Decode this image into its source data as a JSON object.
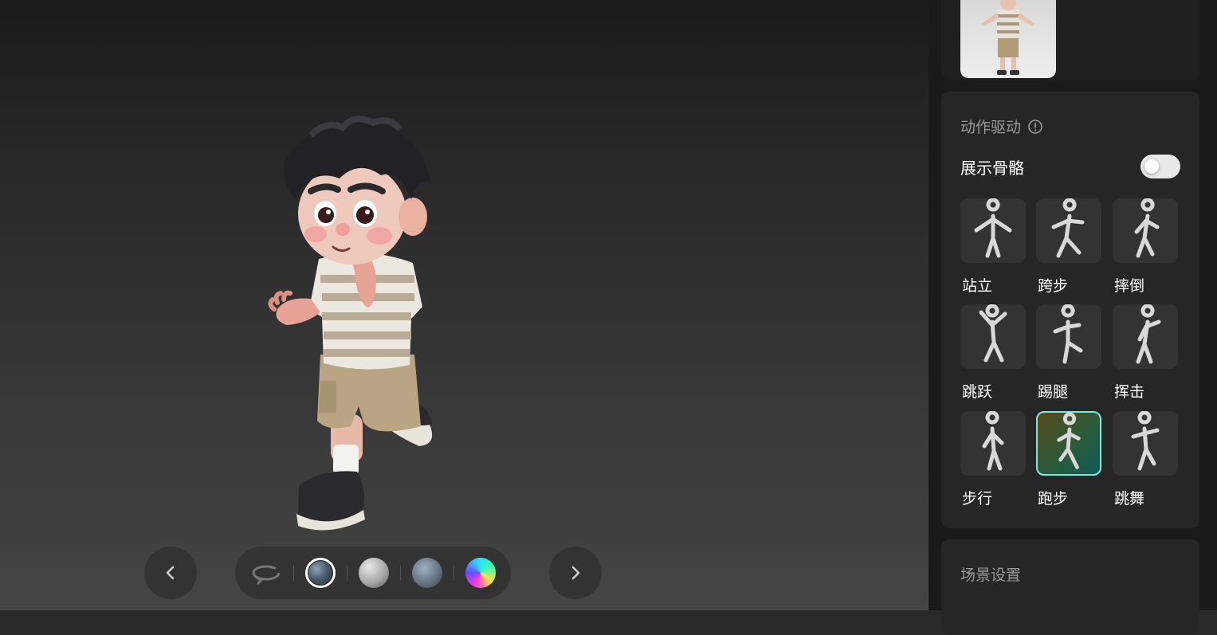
{
  "viewer": {
    "materials": [
      {
        "name": "hdri-sphere-metal",
        "selected": true
      },
      {
        "name": "clay-sphere",
        "selected": false
      },
      {
        "name": "textured-sphere",
        "selected": false
      },
      {
        "name": "rainbow-sphere",
        "selected": false
      }
    ]
  },
  "motion": {
    "title": "动作驱动",
    "show_skeleton_label": "展示骨骼",
    "show_skeleton": true,
    "items": [
      {
        "label": "站立",
        "selected": false
      },
      {
        "label": "跨步",
        "selected": false
      },
      {
        "label": "摔倒",
        "selected": false
      },
      {
        "label": "跳跃",
        "selected": false
      },
      {
        "label": "踢腿",
        "selected": false
      },
      {
        "label": "挥击",
        "selected": false
      },
      {
        "label": "步行",
        "selected": false
      },
      {
        "label": "跑步",
        "selected": true
      },
      {
        "label": "跳舞",
        "selected": false
      }
    ]
  },
  "scene": {
    "title": "场景设置"
  },
  "colors": {
    "accent": "#7ee8e0",
    "panel": "#262626",
    "sidebar": "#1a1a1a"
  }
}
